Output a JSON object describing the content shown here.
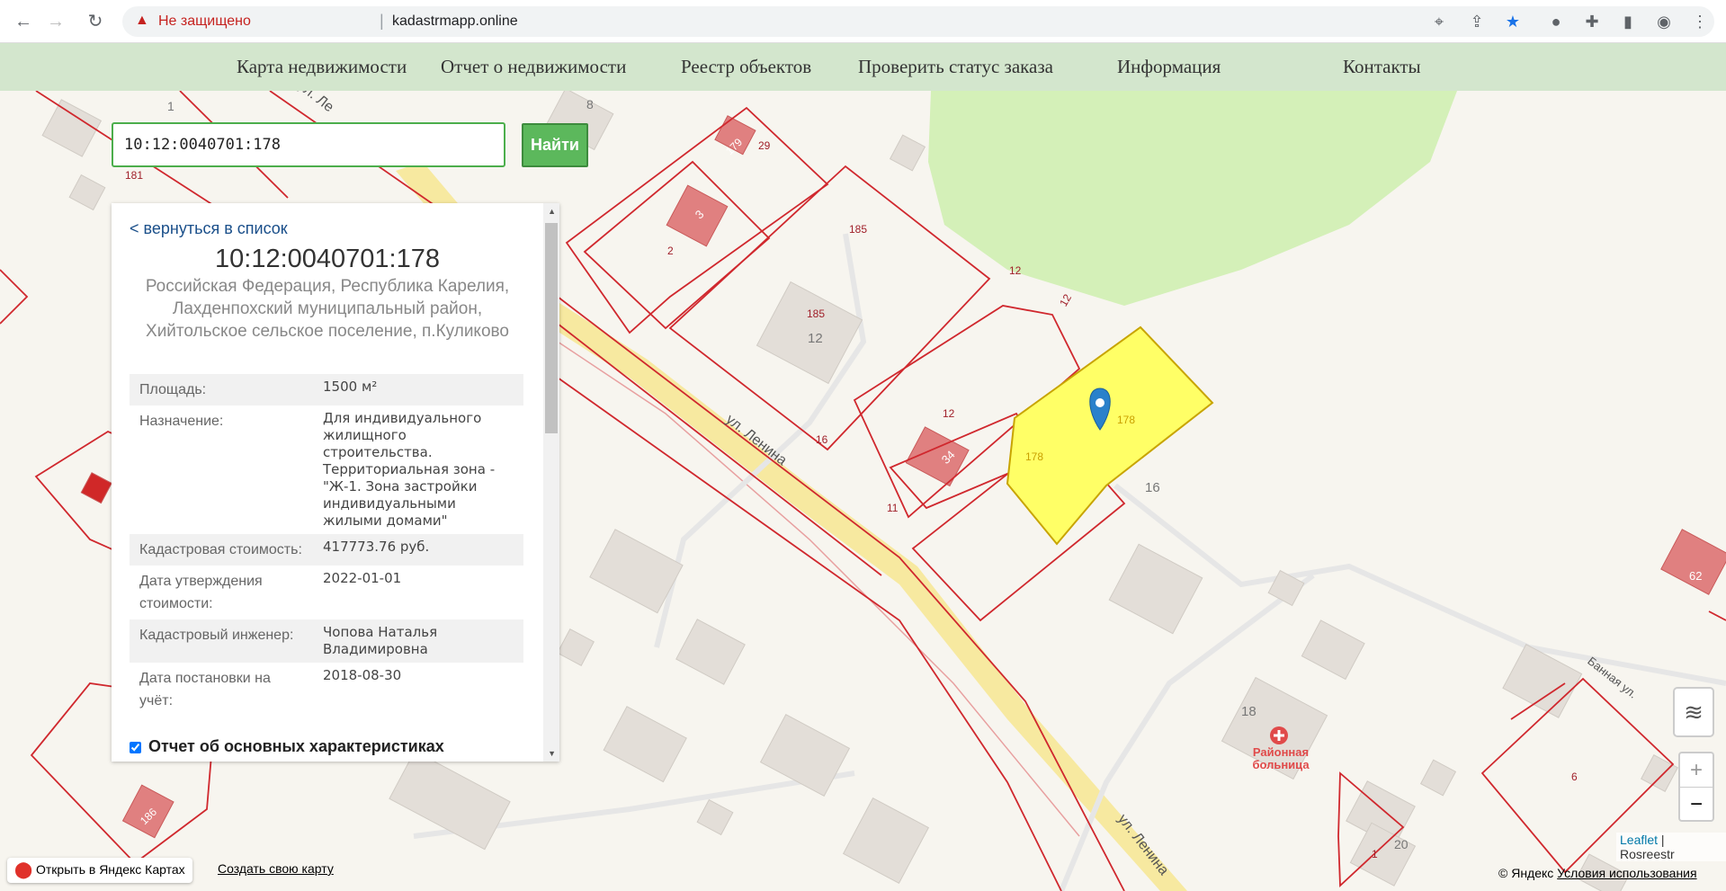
{
  "browser": {
    "back_icon": "←",
    "forward_icon": "→",
    "reload_icon": "↻",
    "security_label": "Не защищено",
    "url": "kadastrmapp.online"
  },
  "site_nav": [
    "Карта недвижимости",
    "Отчет о недвижимости",
    "Реестр объектов",
    "Проверить статус заказа",
    "Информация",
    "Контакты"
  ],
  "search": {
    "value": "10:12:0040701:178",
    "button": "Найти"
  },
  "panel": {
    "back_link": "< вернуться в список",
    "cadastral_number": "10:12:0040701:178",
    "address": "Российская Федерация, Республика Карелия, Лахденпохский муниципальный район, Хийтольское сельское поселение, п.Куликово",
    "properties": [
      {
        "label": "Площадь:",
        "value": "1500 м²"
      },
      {
        "label": "Назначение:",
        "value": "Для индивидуального жилищного строительства. Территориальная зона - \"Ж-1. Зона застройки индивидуальными жилыми домами\""
      },
      {
        "label": "Кадастровая стоимость:",
        "value": "417773.76 руб."
      },
      {
        "label": "Дата утверждения стоимости:",
        "value": "2022-01-01"
      },
      {
        "label": "Кадастровый инженер:",
        "value": "Чопова Наталья Владимировна"
      },
      {
        "label": "Дата постановки на учёт:",
        "value": "2018-08-30"
      }
    ],
    "report_checkbox_label": "Отчет об основных характеристиках",
    "report_checked": true
  },
  "map": {
    "street_labels": [
      "ул. Ленина",
      "ул. Ленина",
      "ул. Ле",
      "Банная ул."
    ],
    "parcel_labels": [
      "178",
      "178",
      "185",
      "185",
      "12",
      "12",
      "12",
      "29",
      "16",
      "11",
      "181",
      "2",
      "6",
      "1"
    ],
    "building_labels": [
      "12",
      "16",
      "18",
      "20",
      "1",
      "8",
      "62",
      "34",
      "179",
      "3",
      "186"
    ],
    "poi": {
      "name": "Районная больница",
      "color": "#e04a4a"
    },
    "selected_parcel_color": "#ffff66",
    "parcel_line_color": "#d0282e"
  },
  "controls": {
    "zoom_in": "+",
    "zoom_out": "−",
    "layers_icon": "layers-icon"
  },
  "attribution": {
    "leaflet": "Leaflet",
    "sep": " | ",
    "source": "Rosreestr"
  },
  "yandex": {
    "open": "Открыть в Яндекс Картах",
    "create": "Создать свою карту",
    "copyright": "© Яндекс",
    "terms": "Условия использования"
  }
}
